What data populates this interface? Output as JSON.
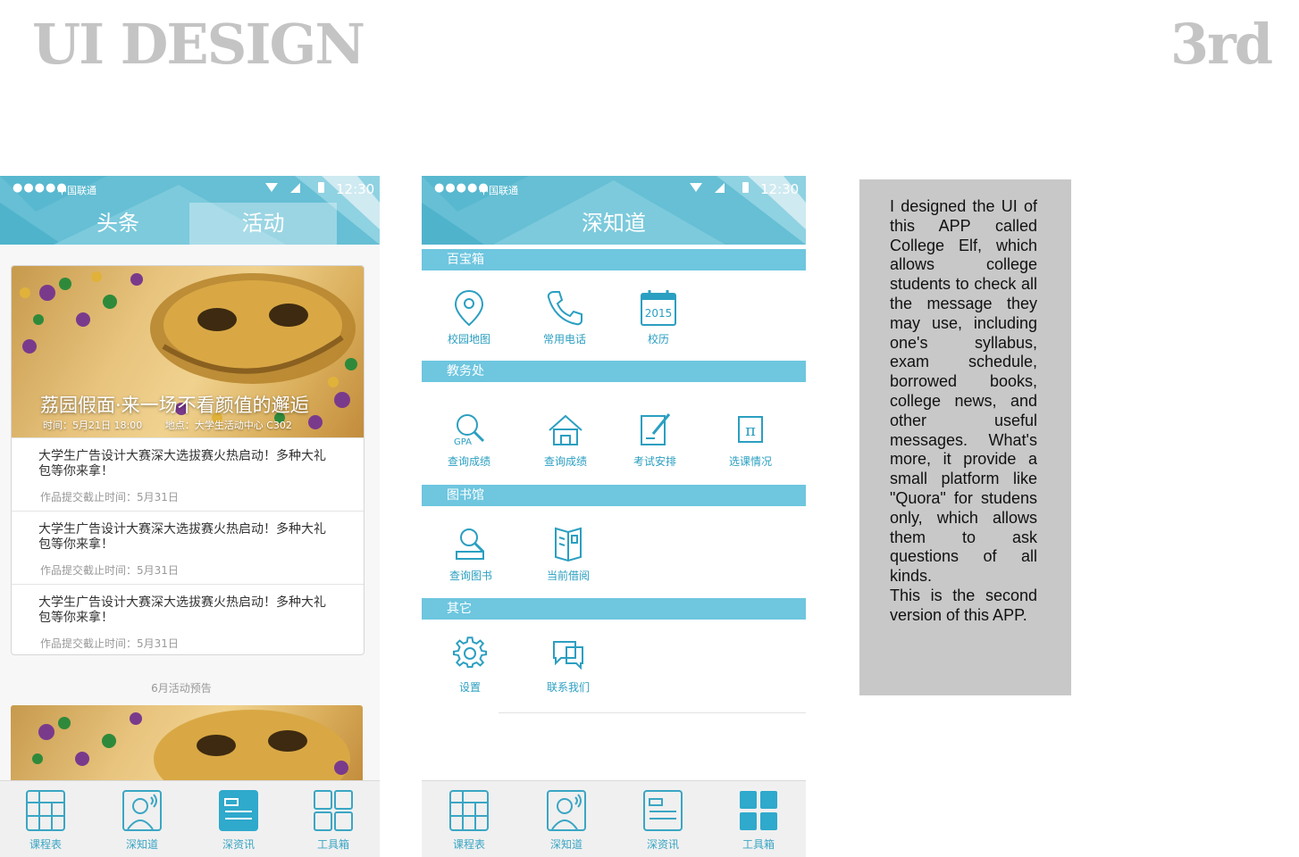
{
  "page": {
    "title": "UI DESIGN",
    "number": "3rd"
  },
  "status_bar": {
    "dots": "●●●●●",
    "carrier": "中国联通",
    "time": "12:30"
  },
  "screen1": {
    "tabs": [
      "头条",
      "活动"
    ],
    "banner": {
      "title": "荔园假面·来一场不看颜值的邂逅",
      "time": "时间：5月21日 18:00",
      "location": "地点：大学生活动中心 C302"
    },
    "news": [
      {
        "title": "大学生广告设计大赛深大选拔赛火热启动！多种大礼包等你来拿！",
        "deadline": "作品提交截止时间：5月31日"
      },
      {
        "title": "大学生广告设计大赛深大选拔赛火热启动！多种大礼包等你来拿！",
        "deadline": "作品提交截止时间：5月31日"
      },
      {
        "title": "大学生广告设计大赛深大选拔赛火热启动！多种大礼包等你来拿！",
        "deadline": "作品提交截止时间：5月31日"
      }
    ],
    "preview_label": "6月活动预告"
  },
  "screen2": {
    "title": "深知道",
    "sections": [
      {
        "name": "百宝箱",
        "items": [
          {
            "label": "校园地图",
            "icon": "map-pin-icon"
          },
          {
            "label": "常用电话",
            "icon": "phone-icon"
          },
          {
            "label": "校历",
            "icon": "calendar-icon",
            "icon_text": "2015"
          }
        ]
      },
      {
        "name": "教务处",
        "items": [
          {
            "label": "查询成绩",
            "icon": "gpa-search-icon",
            "icon_text": "GPA"
          },
          {
            "label": "查询成绩",
            "icon": "home-icon"
          },
          {
            "label": "考试安排",
            "icon": "exam-edit-icon"
          },
          {
            "label": "选课情况",
            "icon": "pi-icon",
            "icon_text": "π"
          }
        ]
      },
      {
        "name": "图书馆",
        "items": [
          {
            "label": "查询图书",
            "icon": "book-search-icon"
          },
          {
            "label": "当前借阅",
            "icon": "open-book-icon"
          }
        ]
      },
      {
        "name": "其它",
        "items": [
          {
            "label": "设置",
            "icon": "gear-icon"
          },
          {
            "label": "联系我们",
            "icon": "chat-icon"
          }
        ]
      }
    ]
  },
  "tabbar": [
    {
      "label": "课程表",
      "icon": "timetable-icon"
    },
    {
      "label": "深知道",
      "icon": "user-icon"
    },
    {
      "label": "深资讯",
      "icon": "news-icon"
    },
    {
      "label": "工具箱",
      "icon": "toolbox-icon"
    }
  ],
  "description": "I designed the UI of this APP called College Elf, which allows college students to check all the message they may use, including one's syllabus, exam schedule, borrowed books, college news, and other useful messages. What's more, it provide a small platform like \"Quora\" for studens only, which allows them to ask questions of all kinds.\nThis is the second version of this APP.",
  "colors": {
    "header": "#66bfd4",
    "section": "#6ec6df",
    "icon": "#2b9fc1",
    "title_gray": "#c4c4c4",
    "desc_bg": "#c8c8c8"
  }
}
